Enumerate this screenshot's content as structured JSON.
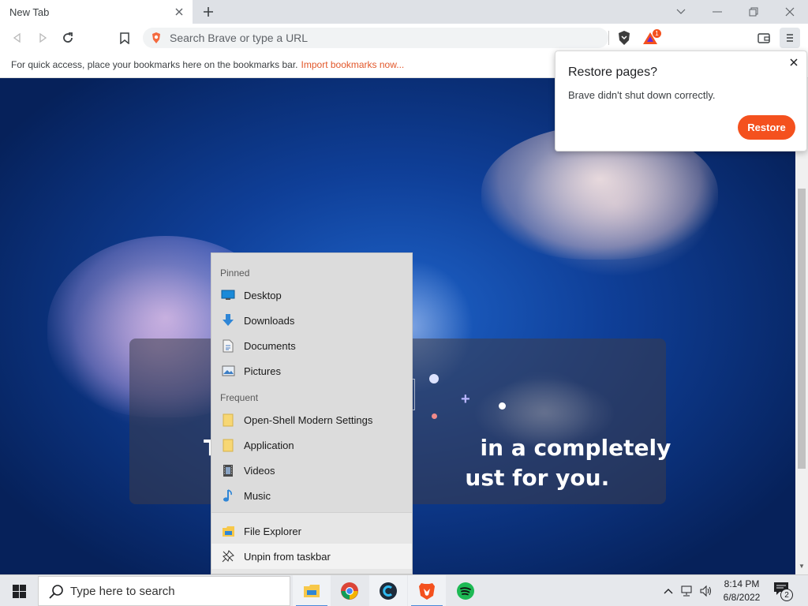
{
  "browser": {
    "tab": {
      "title": "New Tab"
    },
    "omnibox": {
      "placeholder": "Search Brave or type a URL"
    },
    "rewards_badge": "1",
    "bookmarks_bar": {
      "text": "For quick access, place your bookmarks here on the bookmarks bar.",
      "import_link": "Import bookmarks now..."
    }
  },
  "restore_popup": {
    "title": "Restore pages?",
    "message": "Brave didn't shut down correctly.",
    "button": "Restore"
  },
  "page": {
    "hero_line1": "T                                  in a completely",
    "hero_line2": "                                  ust for you."
  },
  "jump_list": {
    "pinned_heading": "Pinned",
    "pinned": [
      {
        "label": "Desktop",
        "icon": "desktop-icon"
      },
      {
        "label": "Downloads",
        "icon": "download-arrow-icon"
      },
      {
        "label": "Documents",
        "icon": "document-icon"
      },
      {
        "label": "Pictures",
        "icon": "picture-icon"
      }
    ],
    "frequent_heading": "Frequent",
    "frequent": [
      {
        "label": "Open-Shell Modern Settings",
        "icon": "folder-icon"
      },
      {
        "label": "Application",
        "icon": "folder-icon"
      },
      {
        "label": "Videos",
        "icon": "film-icon"
      },
      {
        "label": "Music",
        "icon": "music-note-icon"
      }
    ],
    "tasks": [
      {
        "label": "File Explorer",
        "icon": "file-explorer-icon"
      },
      {
        "label": "Unpin from taskbar",
        "icon": "unpin-icon"
      }
    ]
  },
  "taskbar": {
    "search_placeholder": "Type here to search",
    "clock_time": "8:14 PM",
    "clock_date": "6/8/2022",
    "notification_count": "2"
  },
  "colors": {
    "brave_orange": "#f4511e",
    "link_orange": "#e2572a",
    "chrome_bg": "#dee1e6",
    "taskbar_bg": "#e6e8ec"
  }
}
